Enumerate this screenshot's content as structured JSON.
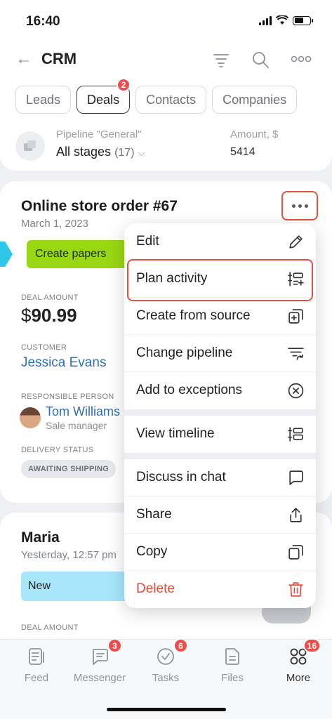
{
  "status_bar": {
    "time": "16:40"
  },
  "header": {
    "title": "CRM",
    "tabs": [
      {
        "label": "Leads"
      },
      {
        "label": "Deals",
        "badge": "2"
      },
      {
        "label": "Contacts"
      },
      {
        "label": "Companies"
      }
    ],
    "pipeline_label": "Pipeline \"General\"",
    "stage_filter": "All stages",
    "stage_count": "(17)",
    "amount_label": "Amount, $",
    "amount_value": "5414"
  },
  "deal1": {
    "title": "Online store order #67",
    "date": "March 1, 2023",
    "stage": "Create papers",
    "amount_label": "DEAL AMOUNT",
    "amount_symbol": "$",
    "amount": "90.99",
    "customer_label": "CUSTOMER",
    "customer": "Jessica Evans",
    "responsible_label": "RESPONSIBLE PERSON",
    "responsible_name": "Tom Williams",
    "responsible_role": "Sale manager",
    "delivery_label": "DELIVERY STATUS",
    "delivery_status": "AWAITING SHIPPING"
  },
  "deal2": {
    "title": "Maria",
    "date": "Yesterday, 12:57 pm",
    "stage": "New",
    "amount_label": "DEAL AMOUNT"
  },
  "menu": {
    "edit": "Edit",
    "plan_activity": "Plan activity",
    "create_from_source": "Create from source",
    "change_pipeline": "Change pipeline",
    "add_to_exceptions": "Add to exceptions",
    "view_timeline": "View timeline",
    "discuss_in_chat": "Discuss in chat",
    "share": "Share",
    "copy": "Copy",
    "delete": "Delete"
  },
  "bottom_nav": {
    "feed": "Feed",
    "messenger": "Messenger",
    "messenger_badge": "3",
    "tasks": "Tasks",
    "tasks_badge": "6",
    "files": "Files",
    "more": "More",
    "more_badge": "16"
  },
  "colors": {
    "accent_highlight": "#e2533f",
    "stage_green": "#9ad713",
    "stage_blue": "#a7e6fb",
    "link": "#2e6fb8",
    "delete": "#e4493c",
    "badge": "#ef4b4b"
  }
}
